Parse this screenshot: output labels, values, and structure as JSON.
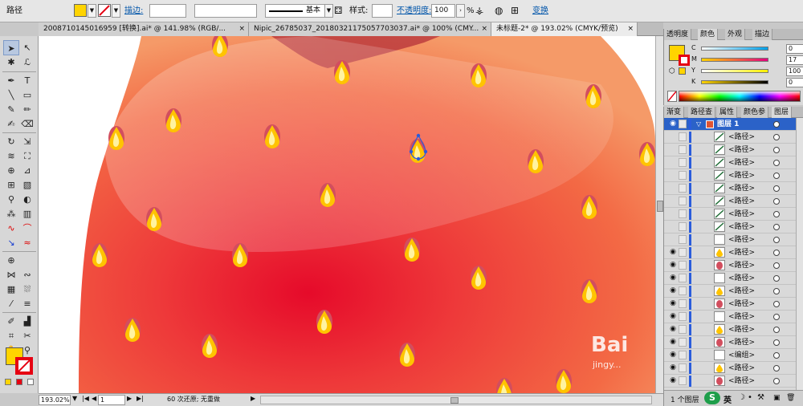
{
  "control_bar": {
    "object_type": "路径",
    "fill_color": "#ffd400",
    "stroke_label": "描边:",
    "stroke_weight": "",
    "profile": "",
    "brush": "基本",
    "style_label": "样式:",
    "opacity_label": "不透明度:",
    "opacity_value": "100",
    "opacity_unit": "%",
    "transform_label": "变换"
  },
  "doc_tabs": [
    {
      "label": "2008710145016959 [转换].ai* @ 141.98% (RGB/..."
    },
    {
      "label": "Nipic_26785037_20180321175057703037.ai* @ 100% (CMY..."
    },
    {
      "label": "未标题-2* @ 193.02% (CMYK/预览)"
    }
  ],
  "tools": {
    "fill_color": "#ffd400",
    "stroke_color": "#e60012"
  },
  "status_bar": {
    "zoom": "193.02%",
    "artboard": "1",
    "history": "60 次还原; 无重做"
  },
  "color_panel": {
    "tabs": [
      "透明度",
      "颜色",
      "外观",
      "描边"
    ],
    "active_tab": "颜色",
    "fill_color": "#ffd400",
    "channels": [
      {
        "name": "C",
        "value": "0",
        "unit": "%",
        "gradient": "linear-gradient(90deg,#ffffff,#00a0e9)"
      },
      {
        "name": "M",
        "value": "17",
        "unit": "%",
        "gradient": "linear-gradient(90deg,#ffd400,#e4007f)"
      },
      {
        "name": "Y",
        "value": "100",
        "unit": "%",
        "gradient": "linear-gradient(90deg,#ffffff,#fff100)"
      },
      {
        "name": "K",
        "value": "0",
        "unit": "%",
        "gradient": "linear-gradient(90deg,#ffd400,#000000)"
      }
    ]
  },
  "layers_panel": {
    "tabs": [
      "渐变",
      "路径查",
      "属性",
      "颜色参",
      "图层"
    ],
    "active_tab": "图层",
    "layer_name": "图层 1",
    "items": [
      {
        "name": "<路径>",
        "thumb": "line"
      },
      {
        "name": "<路径>",
        "thumb": "line"
      },
      {
        "name": "<路径>",
        "thumb": "line"
      },
      {
        "name": "<路径>",
        "thumb": "line"
      },
      {
        "name": "<路径>",
        "thumb": "line"
      },
      {
        "name": "<路径>",
        "thumb": "line"
      },
      {
        "name": "<路径>",
        "thumb": "line"
      },
      {
        "name": "<路径>",
        "thumb": "line"
      },
      {
        "name": "<路径>",
        "thumb": "blank"
      },
      {
        "name": "<路径>",
        "thumb": "seed"
      },
      {
        "name": "<路径>",
        "thumb": "red"
      },
      {
        "name": "<路径>",
        "thumb": "blank"
      },
      {
        "name": "<路径>",
        "thumb": "seed"
      },
      {
        "name": "<路径>",
        "thumb": "red"
      },
      {
        "name": "<路径>",
        "thumb": "blank"
      },
      {
        "name": "<路径>",
        "thumb": "seed"
      },
      {
        "name": "<路径>",
        "thumb": "red"
      },
      {
        "name": "<编组>",
        "thumb": "blank"
      },
      {
        "name": "<路径>",
        "thumb": "seed"
      },
      {
        "name": "<路径>",
        "thumb": "red"
      }
    ],
    "footer_label": "1 个图层"
  },
  "watermark": {
    "brand": "Bai",
    "url": "jingy..."
  }
}
